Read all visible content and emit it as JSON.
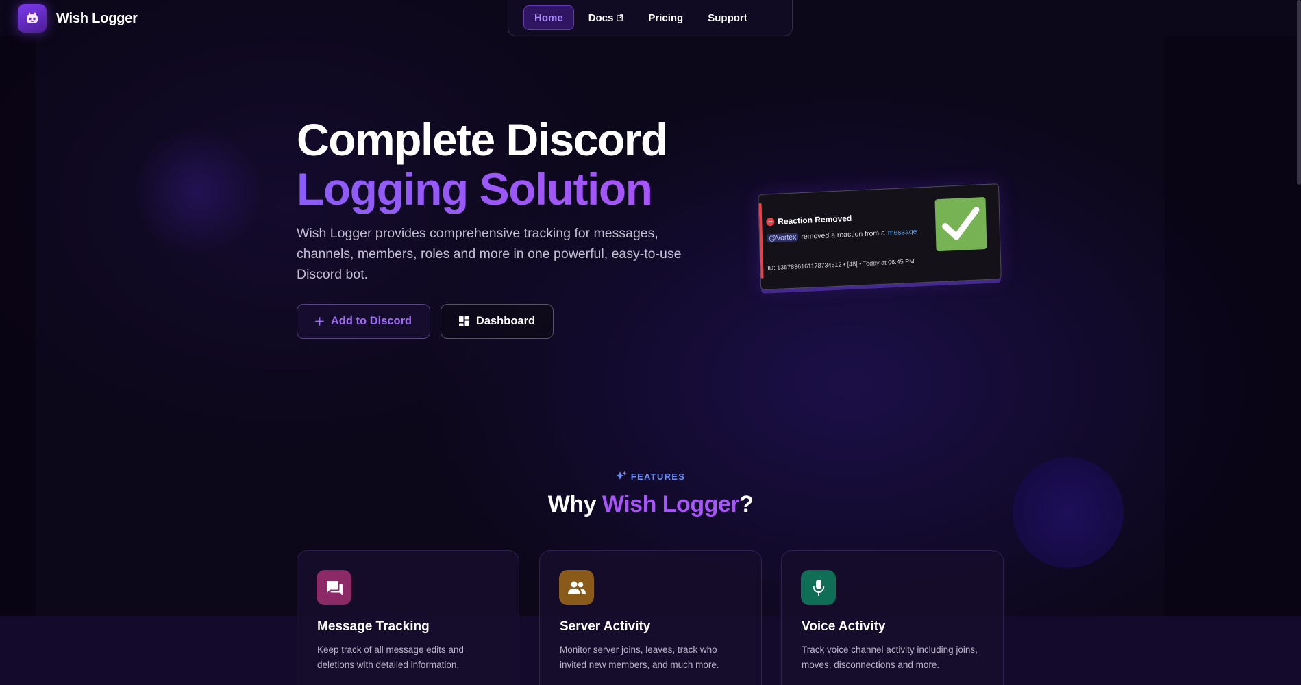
{
  "brand": {
    "name": "Wish Logger",
    "logo_icon": "bot-face-icon"
  },
  "nav": {
    "items": [
      {
        "label": "Home",
        "active": true
      },
      {
        "label": "Docs",
        "external": true,
        "icon": "external-link-icon"
      },
      {
        "label": "Pricing",
        "active": false
      },
      {
        "label": "Support",
        "active": false
      }
    ]
  },
  "hero": {
    "title_line1": "Complete Discord",
    "title_line2": "Logging Solution",
    "description": "Wish Logger provides comprehensive tracking for messages, channels, members, roles and more in one powerful, easy-to-use Discord bot.",
    "add_button": {
      "label": "Add to Discord",
      "icon": "plus-icon"
    },
    "dashboard_button": {
      "label": "Dashboard",
      "icon": "dashboard-grid-icon"
    }
  },
  "discord_card": {
    "title": "Reaction Removed",
    "mention": "@Vortex",
    "action_text": "removed a reaction from a",
    "link_text": "message",
    "footer": "ID: 1387836161178734612 • [48] • Today at 06:45 PM",
    "thumbnail_icon": "check-mark-icon",
    "accent_color": "#e84148"
  },
  "features": {
    "eyebrow": "FEATURES",
    "title_prefix": "Why ",
    "title_accent": "Wish Logger",
    "title_suffix": "?",
    "cards": [
      {
        "title": "Message Tracking",
        "description": "Keep track of all message edits and deletions with detailed information.",
        "icon": "chat-bubbles-icon",
        "color": "#8b2a66"
      },
      {
        "title": "Server Activity",
        "description": "Monitor server joins, leaves, track who invited new members, and much more.",
        "icon": "users-icon",
        "color": "#8a5a1a"
      },
      {
        "title": "Voice Activity",
        "description": "Track voice channel activity including joins, moves, disconnections and more.",
        "icon": "microphone-icon",
        "color": "#0f6e55"
      }
    ]
  },
  "colors": {
    "background": "#0c0719",
    "accent_purple": "#a855f7",
    "accent_blue": "#6b8ef6"
  }
}
